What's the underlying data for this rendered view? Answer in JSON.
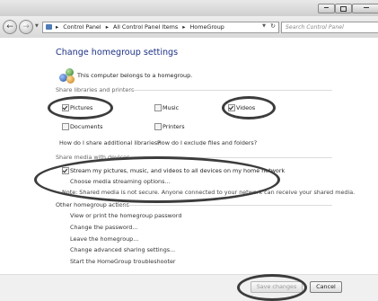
{
  "toolbar": {
    "breadcrumbs": [
      "Control Panel",
      "All Control Panel Items",
      "HomeGroup"
    ],
    "search_placeholder": "Search Control Panel"
  },
  "page": {
    "title": "Change homegroup settings",
    "belongs_text": "This computer belongs to a homegroup."
  },
  "share": {
    "header": "Share libraries and printers",
    "items": {
      "pictures": {
        "label": "Pictures",
        "checked": true
      },
      "music": {
        "label": "Music",
        "checked": false
      },
      "videos": {
        "label": "Videos",
        "checked": true
      },
      "documents": {
        "label": "Documents",
        "checked": false
      },
      "printers": {
        "label": "Printers",
        "checked": false
      }
    },
    "link_libraries": "How do I share additional libraries?",
    "link_exclude": "How do I exclude files and folders?"
  },
  "media": {
    "header": "Share media with devices",
    "stream_label": "Stream my pictures, music, and videos to all devices on my home network",
    "stream_checked": true,
    "options_link": "Choose media streaming options...",
    "note": "Note: Shared media is not secure. Anyone connected to your network can receive your shared media."
  },
  "other": {
    "header": "Other homegroup actions",
    "links": [
      "View or print the homegroup password",
      "Change the password...",
      "Leave the homegroup...",
      "Change advanced sharing settings...",
      "Start the HomeGroup troubleshooter"
    ]
  },
  "buttons": {
    "save": "Save changes",
    "cancel": "Cancel"
  },
  "colors": {
    "title": "#1e3287",
    "highlight_oval": "#3c3c3c"
  }
}
